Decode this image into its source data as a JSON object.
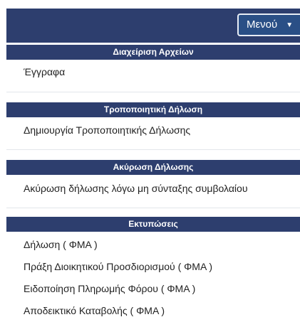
{
  "header": {
    "menu_label": "Μενού"
  },
  "sections": [
    {
      "title": "Διαχείριση Αρχείων",
      "items": [
        "Έγγραφα"
      ]
    },
    {
      "title": "Τροποποιητική Δήλωση",
      "items": [
        "Δημιουργία Τροποποιητικής Δήλωσης"
      ]
    },
    {
      "title": "Ακύρωση Δήλωσης",
      "items": [
        "Ακύρωση δήλωσης λόγω μη σύνταξης συμβολαίου"
      ]
    },
    {
      "title": "Εκτυπώσεις",
      "items": [
        "Δήλωση ( ΦΜΑ )",
        "Πράξη Διοικητικού Προσδιορισμού ( ΦΜΑ )",
        "Ειδοποίηση Πληρωμής Φόρου ( ΦΜΑ )",
        "Αποδεικτικό Καταβολής ( ΦΜΑ )"
      ]
    }
  ],
  "colors": {
    "header_bg": "#2d3e6e",
    "menu_button_bg": "#2a4f86",
    "divider": "#e3e6ea"
  },
  "icons": {
    "menu_caret": "caret-down-icon"
  }
}
